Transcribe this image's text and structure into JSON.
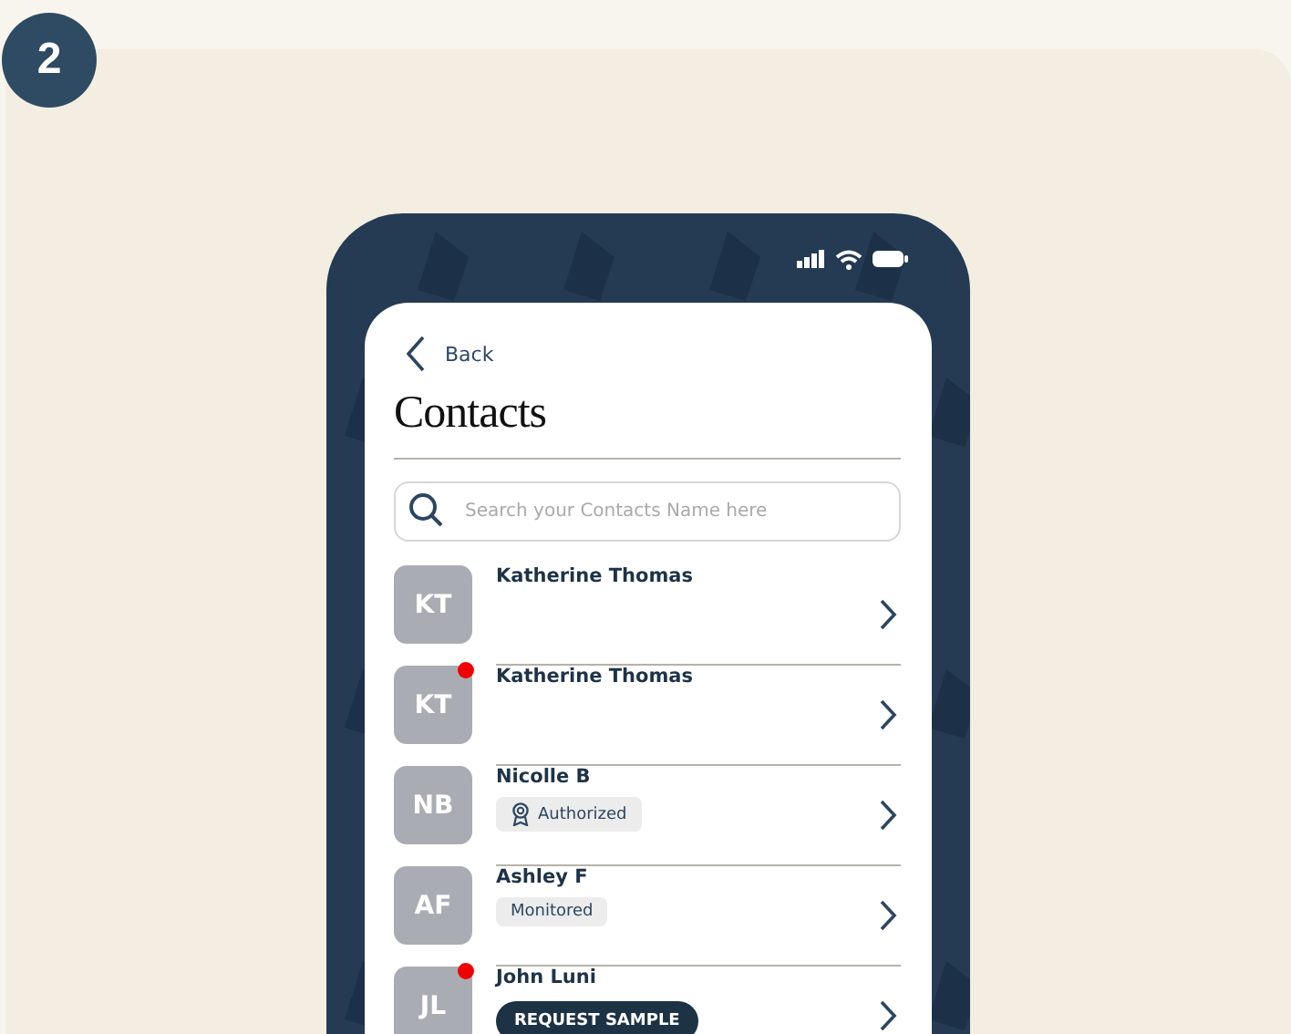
{
  "step_badge": "2",
  "phone": {
    "back_label": "Back",
    "title": "Contacts",
    "search": {
      "placeholder": "Search your Contacts Name here"
    },
    "contacts": [
      {
        "initials": "KT",
        "name": "Katherine Thomas",
        "unread": false
      },
      {
        "initials": "KT",
        "name": "Katherine Thomas",
        "unread": true
      },
      {
        "initials": "NB",
        "name": "Nicolle B",
        "unread": false,
        "tag": {
          "kind": "authorized",
          "label": "Authorized"
        }
      },
      {
        "initials": "AF",
        "name": "Ashley F",
        "unread": false,
        "tag": {
          "kind": "monitored",
          "label": "Monitored"
        }
      },
      {
        "initials": "JL",
        "name": "John Luni",
        "unread": true,
        "tag": {
          "kind": "action",
          "label": "REQUEST SAMPLE"
        }
      }
    ]
  }
}
